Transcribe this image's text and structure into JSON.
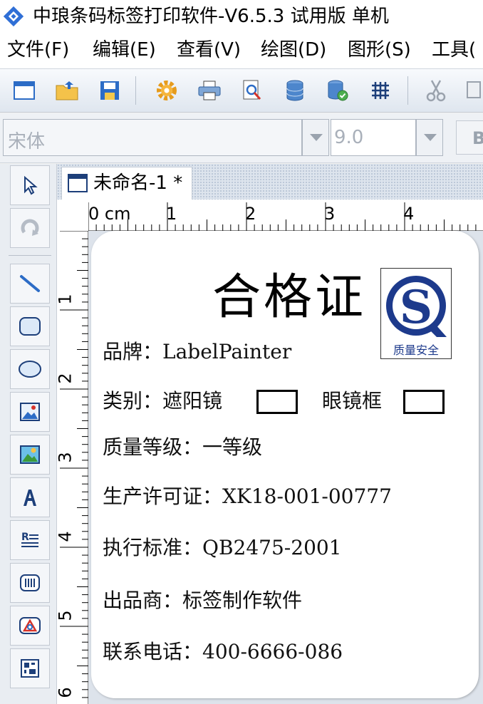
{
  "window": {
    "title": "中琅条码标签打印软件-V6.5.3 试用版 单机"
  },
  "menu": {
    "items": [
      {
        "label": "文件(F)"
      },
      {
        "label": "编辑(E)"
      },
      {
        "label": "查看(V)"
      },
      {
        "label": "绘图(D)"
      },
      {
        "label": "图形(S)"
      },
      {
        "label": "工具("
      }
    ]
  },
  "toolbar": {
    "icons": [
      "new-document-icon",
      "open-folder-icon",
      "save-icon",
      "settings-gear-icon",
      "print-icon",
      "print-preview-icon",
      "database-icon",
      "database-settings-icon",
      "grid-icon",
      "cut-icon",
      "copy-icon"
    ]
  },
  "fontbar": {
    "font_name": "宋体",
    "font_size": "9.0",
    "bold_label": "B"
  },
  "palette": {
    "tools": [
      "select-arrow-icon",
      "rotate-icon",
      "line-icon",
      "rounded-rectangle-icon",
      "ellipse-icon",
      "image-icon",
      "image-color-icon",
      "text-icon",
      "rich-text-icon",
      "barcode-icon",
      "shape-triangle-icon",
      "qrcode-icon"
    ]
  },
  "document": {
    "tab_label": "未命名-1 *"
  },
  "ruler": {
    "unit": "cm",
    "top_labels": [
      "0",
      "1",
      "2",
      "3",
      "4"
    ],
    "left_labels": [
      "1",
      "2",
      "3",
      "4",
      "5",
      "6"
    ]
  },
  "label": {
    "title": "合格证",
    "logo_caption": "质量安全",
    "logo_letter": "S",
    "fields": {
      "brand": "品牌：LabelPainter",
      "category": "类别：遮阳镜",
      "category_option2": "眼镜框",
      "grade": "质量等级：一等级",
      "license": "生产许可证：XK18-001-00777",
      "standard": "执行标准：QB2475-2001",
      "manufacturer": "出品商：标签制作软件",
      "phone": "联系电话：400-6666-086"
    }
  },
  "colors": {
    "logo_blue": "#1d3a8c",
    "app_icon_blue": "#2f6fd6"
  }
}
